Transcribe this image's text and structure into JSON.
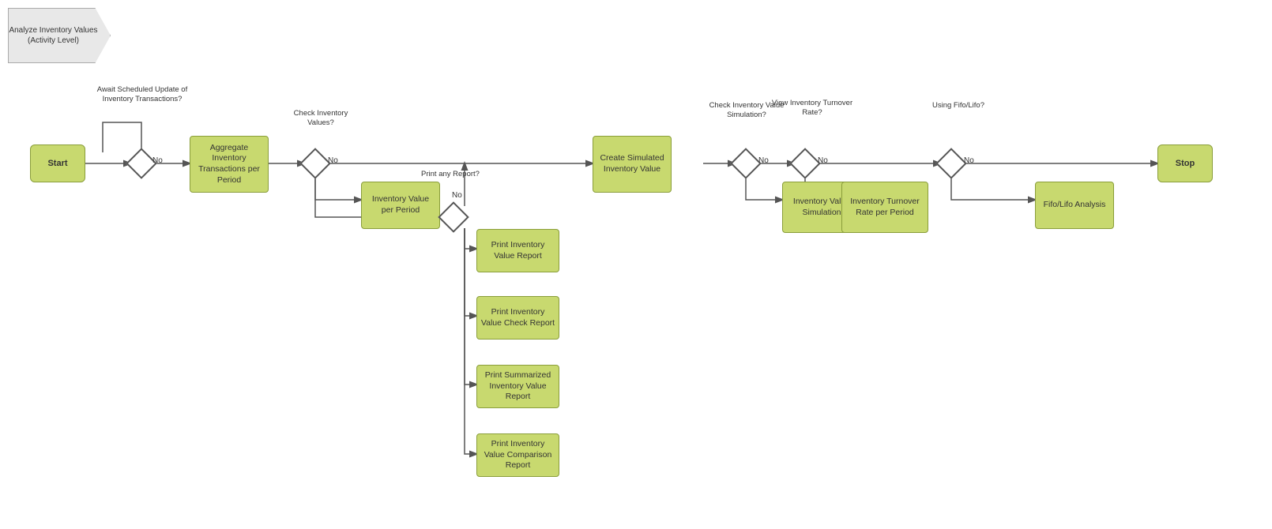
{
  "header": {
    "title": "Analyze Inventory Values (Activity Level)"
  },
  "nodes": {
    "start": {
      "label": "Start"
    },
    "stop": {
      "label": "Stop"
    },
    "aggregate": {
      "label": "Aggregate Inventory Transactions per Period"
    },
    "inventory_value_period": {
      "label": "Inventory Value per Period"
    },
    "create_simulated": {
      "label": "Create Simulated Inventory Value"
    },
    "inventory_value_simulation": {
      "label": "Inventory Value Simulation"
    },
    "inventory_turnover_rate": {
      "label": "Inventory Turnover Rate per Period"
    },
    "fifo_lifo": {
      "label": "Fifo/Lifo Analysis"
    },
    "print_iv_report": {
      "label": "Print Inventory Value Report"
    },
    "print_iv_check": {
      "label": "Print Inventory Value Check Report"
    },
    "print_summarized": {
      "label": "Print Summarized Inventory Value Report"
    },
    "print_iv_comparison": {
      "label": "Print Inventory Value Comparison Report"
    }
  },
  "gateways": {
    "gw1": {
      "question": "Await Scheduled Update of Inventory Transactions?",
      "no_label": "No"
    },
    "gw2": {
      "question": "Check Inventory Values?",
      "no_label": "No"
    },
    "gw3": {
      "question": "Print any Report?",
      "no_label": "No"
    },
    "gw4": {
      "question": "Check Inventory Value Simulation?",
      "no_label": "No"
    },
    "gw5": {
      "question": "View Inventory Turnover Rate?",
      "no_label": "No"
    },
    "gw6": {
      "question": "Using Fifo/Lifo?",
      "no_label": "No"
    }
  }
}
